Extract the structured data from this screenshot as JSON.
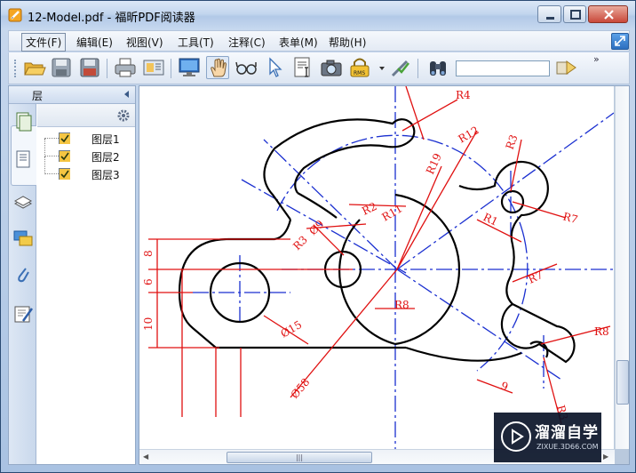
{
  "window": {
    "title": "12-Model.pdf - 福昕PDF阅读器"
  },
  "menu": {
    "items": [
      {
        "label": "文件(F)"
      },
      {
        "label": "编辑(E)"
      },
      {
        "label": "视图(V)"
      },
      {
        "label": "工具(T)"
      },
      {
        "label": "注释(C)"
      },
      {
        "label": "表单(M)"
      },
      {
        "label": "帮助(H)"
      }
    ]
  },
  "toolbar": {
    "icons": [
      "open-folder-icon",
      "save-icon",
      "save-as-icon",
      "print-icon",
      "page-setup-icon",
      "monitor-icon",
      "hand-tool-icon",
      "glasses-icon",
      "select-arrow-icon",
      "text-select-icon",
      "snapshot-icon",
      "rms-lock-icon",
      "sign-tool-icon",
      "binoculars-icon",
      "search-next-icon"
    ],
    "rms_label": "RMS",
    "search_value": "",
    "more": "»"
  },
  "left_panel": {
    "title": "层",
    "layers": [
      {
        "name": "图层1",
        "checked": true
      },
      {
        "name": "图层2",
        "checked": true
      },
      {
        "name": "图层3",
        "checked": true
      }
    ]
  },
  "drawing": {
    "labels": {
      "r4": "R4",
      "r12": "R12",
      "r3": "R3",
      "r19": "R19",
      "r2": "R2",
      "r11": "R11",
      "r1": "R1",
      "r7a": "R7",
      "r7b": "R7",
      "r8a": "R8",
      "r8b": "R8",
      "r3b": "R3",
      "d9": "Ø9",
      "d15": "Ø15",
      "d58": "Ø58",
      "dim8": "8",
      "dim6": "6",
      "dim10": "10",
      "dim9": "9"
    }
  },
  "scroll": {
    "grip": "|||"
  },
  "watermark": {
    "title": "溜溜自学",
    "subtitle": "ZIXUE.3D66.COM"
  }
}
